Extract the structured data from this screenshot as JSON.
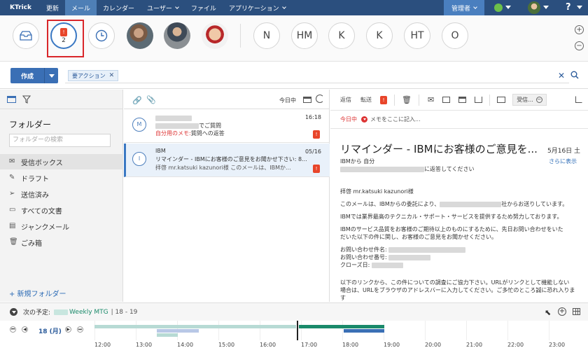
{
  "topnav": {
    "brand": "KTrick",
    "items": [
      "更新",
      "メール",
      "カレンダー",
      "ユーザー",
      "ファイル",
      "アプリケーション"
    ],
    "admin": "管理者"
  },
  "filters": {
    "selected_count": "2",
    "tag_glyph": "!",
    "initials": [
      "N",
      "HM",
      "K",
      "K",
      "HT",
      "O"
    ]
  },
  "compose": {
    "label": "作成"
  },
  "tag_filter": {
    "chip": "要アクション"
  },
  "folders": {
    "title": "フォルダー",
    "search_placeholder": "フォルダーの検索",
    "items": [
      "受信ボックス",
      "ドラフト",
      "送信済み",
      "すべての文書",
      "ジャンクメール",
      "ごみ箱"
    ],
    "new_folder": "+ 新規フォルダー"
  },
  "list": {
    "date_filter": "今日中",
    "messages": [
      {
        "avatar": "M",
        "sender": "",
        "subject": "でご質問",
        "memo_label": "自分用のメモ:",
        "memo_text": "質問への返答",
        "date": "16:18"
      },
      {
        "avatar": "I",
        "sender": "IBM",
        "subject": "リマインダー - IBMにお客様のご意見をお聞かせ下さい: 8...",
        "preview": "拝啓 mr.katsuki kazunori様 このメールは、IBMか...",
        "date": "05/16"
      }
    ]
  },
  "reader": {
    "toolbar": {
      "reply": "返信",
      "forward": "転送",
      "receive": "受信..."
    },
    "memo_due": "今日中",
    "memo_placeholder": "メモをここに記入...",
    "subject": "リマインダー - IBMにお客様のご意見を...",
    "date": "5月16日 土",
    "from": "IBMから 自分",
    "show_more": "さらに表示",
    "to_line": "に返答してください",
    "body": {
      "greeting": "拝啓 mr.katsuki kazunori様",
      "p1a": "このメールは、IBMからの委託により、",
      "p1b": "社からお送りしています。",
      "p2": "IBMでは業界最高のテクニカル・サポート・サービスを提供するため努力しております。",
      "p3a": "IBMのサービス品質をお客様のご期待以上のものにするために、先日お問い合わせをいた",
      "p3b": "だいた以下の件に関し、お客様のご意見をお聞かせください。",
      "f1": "お問い合わせ件名:",
      "f2": "お問い合わせ番号:",
      "f3": "クローズ日:",
      "p4a": "以下のリンクから、この件についての調査にご協力下さい。URLがリンクとして機能しない",
      "p4b": "場合は、URLをブラウザのアドレスバーに入力してください。ご多忙のところ誠に恐れ入ります"
    }
  },
  "schedule": {
    "next_label": "次の予定:",
    "event_title": "Weekly MTG",
    "event_time": "| 18 - 19",
    "day": "18 (月)",
    "hours": [
      "12:00",
      "13:00",
      "14:00",
      "15:00",
      "16:00",
      "17:00",
      "18:00",
      "19:00",
      "20:00",
      "21:00",
      "22:00",
      "23:00"
    ]
  },
  "colors": {
    "nav_bg": "#2b4f7e",
    "accent": "#3a78c3",
    "action_tag": "#e8452a",
    "memo_red": "#d33",
    "event_green": "#1a8a6a"
  }
}
